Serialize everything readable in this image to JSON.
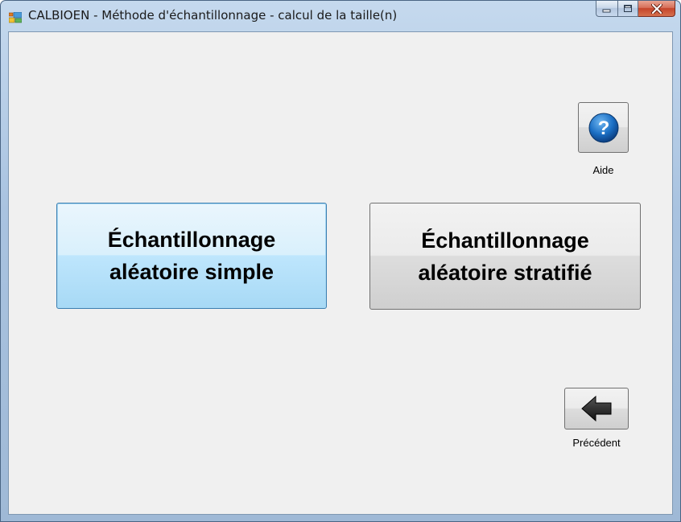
{
  "window": {
    "title": "CALBIOEN - Méthode d'échantillonnage - calcul de la taille(n)"
  },
  "buttons": {
    "simple": {
      "line1": "Échantillonnage",
      "line2": "aléatoire simple"
    },
    "stratified": {
      "line1": "Échantillonnage",
      "line2": "aléatoire stratifié"
    },
    "help": {
      "label": "Aide",
      "icon": "help-question-icon"
    },
    "previous": {
      "label": "Précédent",
      "icon": "arrow-left-icon"
    }
  },
  "colors": {
    "help_icon": "#1b6fc4",
    "arrow_icon": "#1c1c1c",
    "close_button": "#c5442a",
    "client_background": "#f0f0f0"
  }
}
